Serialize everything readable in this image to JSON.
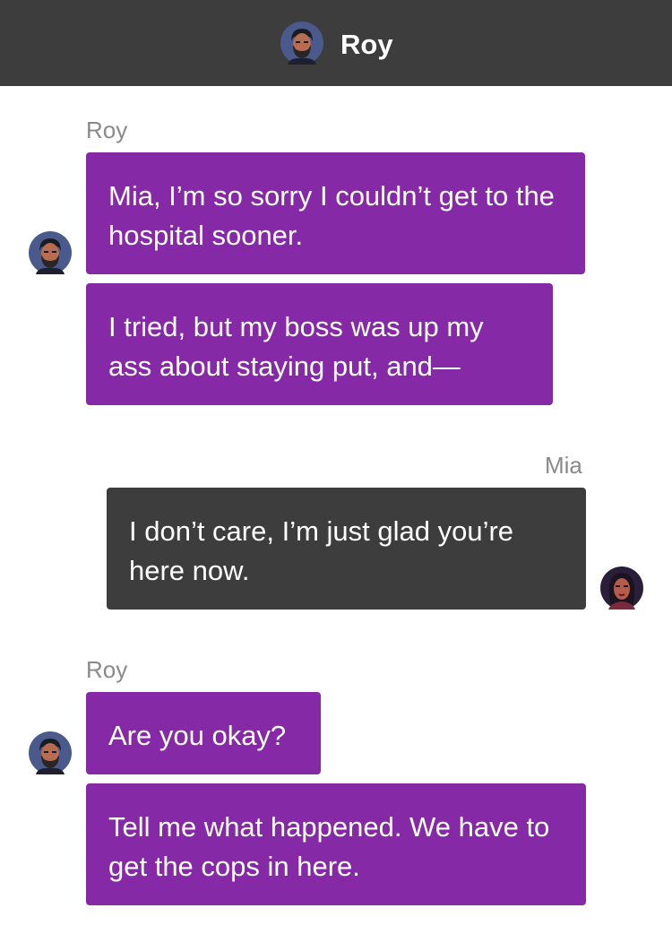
{
  "header": {
    "title": "Roy",
    "avatar_icon": "roy-avatar-icon"
  },
  "colors": {
    "header_bg": "#3d3d3d",
    "roy_bubble": "#8529a6",
    "mia_bubble": "#3d3d3d",
    "sender_label": "#8a8a8a"
  },
  "messages": [
    {
      "sender": "Roy",
      "lines": [
        "Mia, I’m so sorry I couldn’t get to the hospital sooner.",
        "I tried, but my boss was up my ass about staying put, and—"
      ]
    },
    {
      "sender": "Mia",
      "lines": [
        "I don’t care, I’m just glad you’re here now."
      ]
    },
    {
      "sender": "Roy",
      "lines": [
        "Are you okay?",
        "Tell me what happened. We have to get the cops in here."
      ]
    }
  ]
}
